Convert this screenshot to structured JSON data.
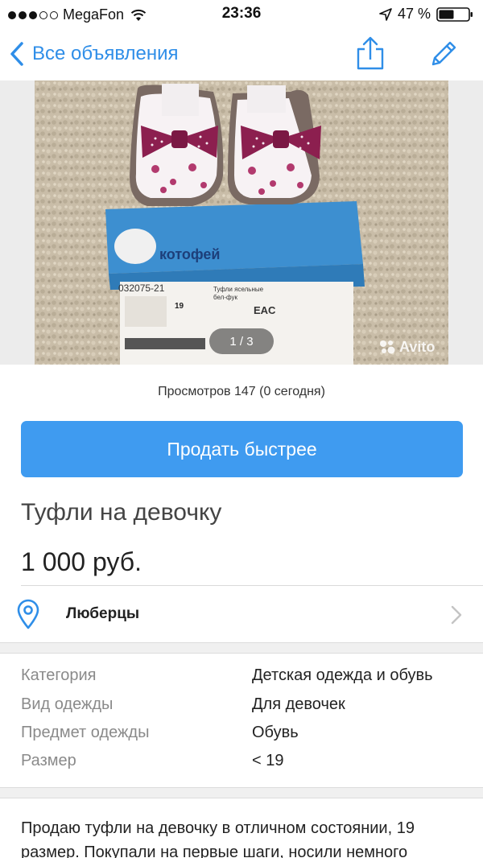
{
  "status_bar": {
    "carrier": "MegaFon",
    "time": "23:36",
    "battery": "47 %",
    "signal_bars_filled": 3,
    "signal_bars_total": 5
  },
  "nav": {
    "back_label": "Все объявления",
    "accent_color": "#2f8ee8"
  },
  "gallery": {
    "counter": "1 / 3",
    "watermark": "Avito",
    "box_brand": "котофей",
    "box_article": "032075-21",
    "box_product": "Туфли ясельные",
    "box_color": "бел-фук",
    "box_size": "19"
  },
  "listing": {
    "views": "Просмотров 147 (0 сегодня)",
    "sell_button": "Продать быстрее",
    "sell_button_color": "#3f9bf0",
    "title": "Туфли на девочку",
    "price": "1 000 руб.",
    "location": "Люберцы"
  },
  "properties": [
    {
      "label": "Категория",
      "value": "Детская одежда и обувь"
    },
    {
      "label": "Вид одежды",
      "value": "Для девочек"
    },
    {
      "label": "Предмет одежды",
      "value": "Обувь"
    },
    {
      "label": "Размер",
      "value": "< 19"
    }
  ],
  "description": "Продаю туфли на девочку в отличном состоянии, 19 размер. Покупали на первые шаги, носили немного"
}
